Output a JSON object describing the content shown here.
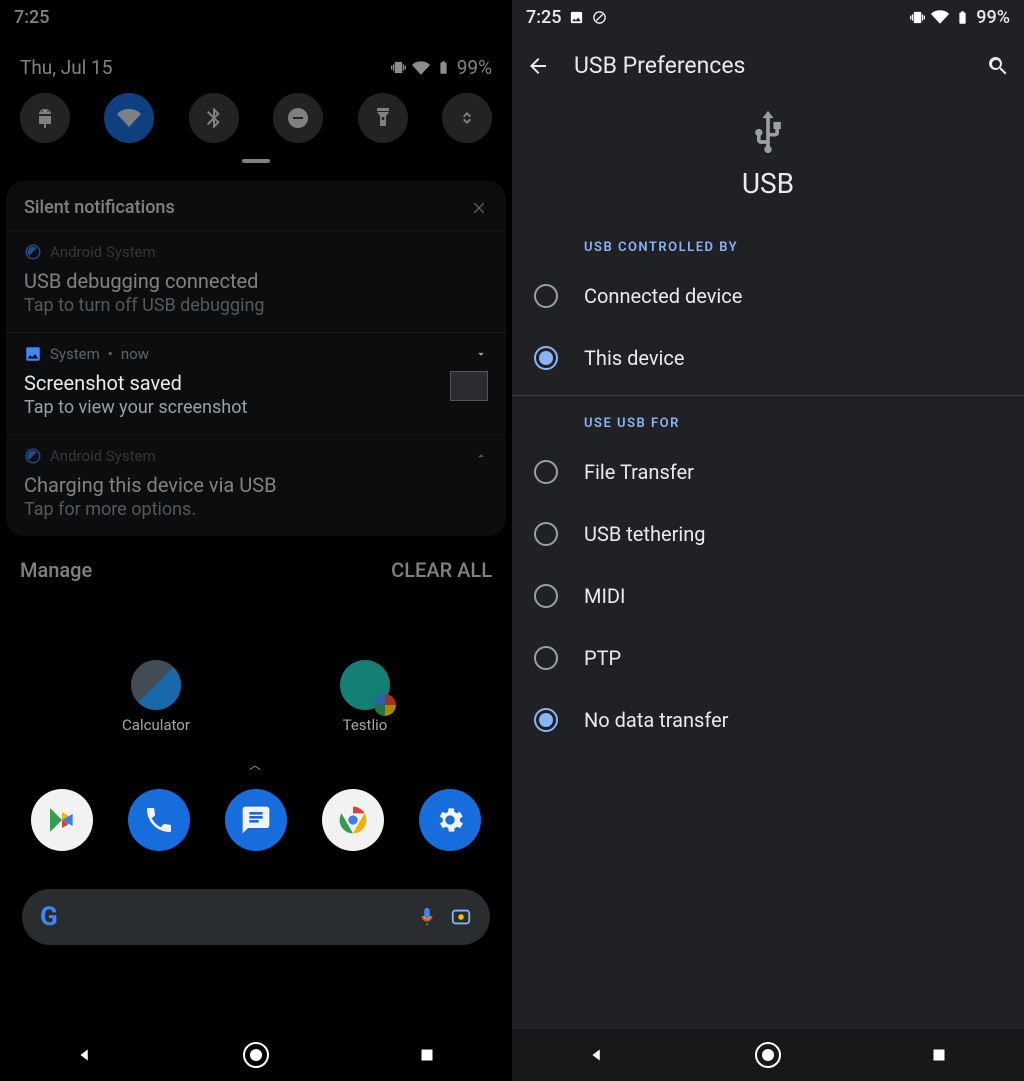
{
  "left": {
    "status": {
      "time": "7:25",
      "battery": "99%"
    },
    "qs": {
      "date": "Thu, Jul 15",
      "battery": "99%",
      "toggles": [
        {
          "name": "android-head",
          "active": false
        },
        {
          "name": "wifi",
          "active": true
        },
        {
          "name": "bluetooth",
          "active": false
        },
        {
          "name": "dnd",
          "active": false
        },
        {
          "name": "flashlight",
          "active": false
        },
        {
          "name": "rotate",
          "active": false
        }
      ]
    },
    "silent_header": "Silent notifications",
    "notifications": [
      {
        "app": "Android System",
        "title": "USB debugging connected",
        "body": "Tap to turn off USB debugging",
        "expand": "down"
      },
      {
        "app": "System",
        "time": "now",
        "title": "Screenshot saved",
        "body": "Tap to view your screenshot",
        "thumb": true,
        "expand": "down"
      },
      {
        "app": "Android System",
        "title": "Charging this device via USB",
        "body": "Tap for more options.",
        "expand": "up"
      }
    ],
    "actions": {
      "manage": "Manage",
      "clear": "CLEAR ALL"
    },
    "home_apps": [
      {
        "label": "Calculator",
        "kind": "calc"
      },
      {
        "label": "Testlio",
        "kind": "testlio"
      }
    ],
    "dock": [
      "play",
      "phone",
      "messages",
      "chrome",
      "settings"
    ]
  },
  "right": {
    "status": {
      "time": "7:25",
      "battery": "99%"
    },
    "title": "USB Preferences",
    "hero_label": "USB",
    "section_controlled": "USB CONTROLLED BY",
    "controlled_options": [
      {
        "label": "Connected device",
        "selected": false
      },
      {
        "label": "This device",
        "selected": true
      }
    ],
    "section_use": "USE USB FOR",
    "use_options": [
      {
        "label": "File Transfer",
        "selected": false
      },
      {
        "label": "USB tethering",
        "selected": false
      },
      {
        "label": "MIDI",
        "selected": false
      },
      {
        "label": "PTP",
        "selected": false
      },
      {
        "label": "No data transfer",
        "selected": true
      }
    ]
  }
}
